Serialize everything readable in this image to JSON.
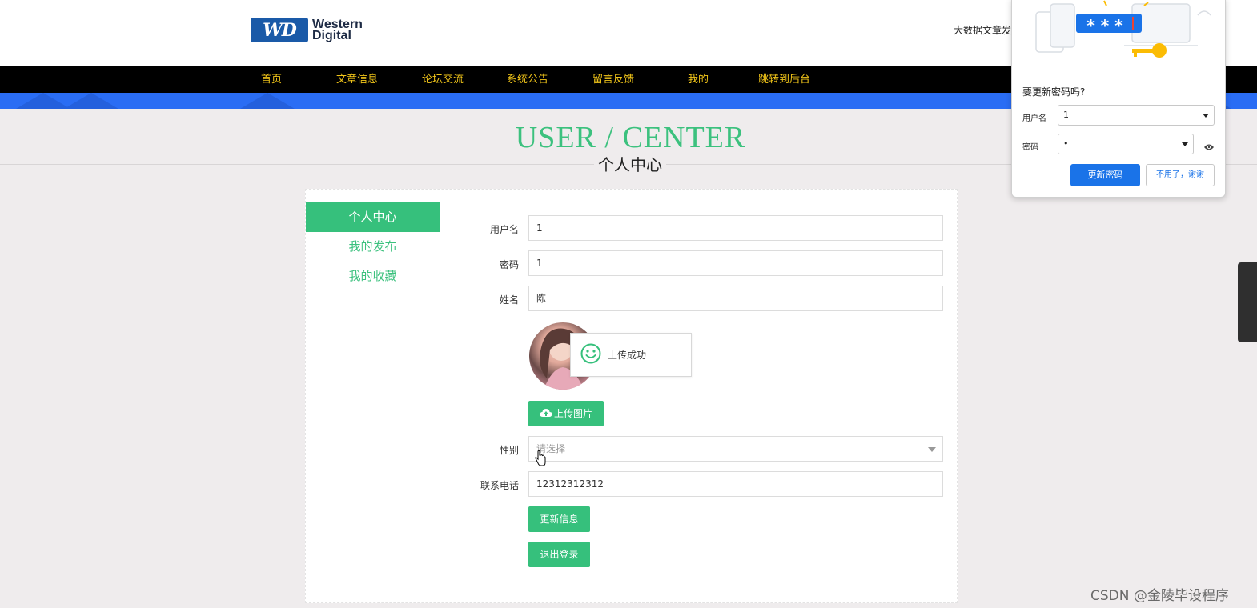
{
  "header": {
    "logo_badge": "WD",
    "logo_line1": "Western",
    "logo_line2": "Digital",
    "site_title": "大数据文章发"
  },
  "nav": {
    "items": [
      "首页",
      "文章信息",
      "论坛交流",
      "系统公告",
      "留言反馈",
      "我的",
      "跳转到后台"
    ]
  },
  "page": {
    "title_en": "USER / CENTER",
    "title_cn": "个人中心"
  },
  "sidebar": {
    "items": [
      {
        "label": "个人中心",
        "active": true
      },
      {
        "label": "我的发布",
        "active": false
      },
      {
        "label": "我的收藏",
        "active": false
      }
    ]
  },
  "form": {
    "username_label": "用户名",
    "username_value": "1",
    "password_label": "密码",
    "password_value": "1",
    "name_label": "姓名",
    "name_value": "陈一",
    "upload_toast": "上传成功",
    "upload_button": "上传图片",
    "gender_label": "性别",
    "gender_placeholder": "请选择",
    "phone_label": "联系电话",
    "phone_value": "12312312312",
    "update_button": "更新信息",
    "logout_button": "退出登录"
  },
  "password_popup": {
    "question": "要更新密码吗?",
    "username_label": "用户名",
    "username_value": "1",
    "password_label": "密码",
    "password_value": "•",
    "stars": "* * *",
    "update_button": "更新密码",
    "dismiss_button": "不用了，谢谢",
    "accent": "#1a73e8"
  },
  "watermark": "CSDN @金陵毕设程序",
  "colors": {
    "accent_green": "#36c07c",
    "nav_bg": "#000000",
    "nav_text": "#f0c419",
    "banner_blue": "#2a6df4"
  }
}
